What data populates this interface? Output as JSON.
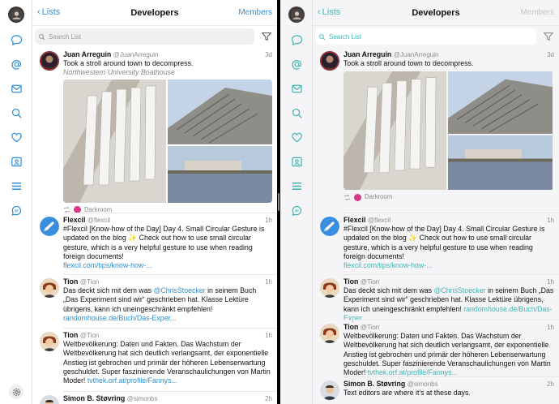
{
  "colors": {
    "accent_left": "#2f8fd8",
    "accent_right": "#3fb6b5",
    "retweet_icon": "#8a8a8e",
    "darkroom": "#d9368b"
  },
  "header": {
    "back_label": "Lists",
    "title": "Developers",
    "members_label": "Members"
  },
  "search": {
    "placeholder": "Search List"
  },
  "nav_icons": [
    "avatar",
    "speech-bubble-icon",
    "at-icon",
    "mail-icon",
    "search-icon",
    "heart-icon",
    "contact-card-icon",
    "list-icon",
    "chat-bubble-icon",
    "gear-icon"
  ],
  "tweets": [
    {
      "name": "Juan Arreguin",
      "handle": "@JuanArreguin",
      "time": "3d",
      "text": "Took a stroll around town to decompress.",
      "location": "Northwestern University Boathouse",
      "app": "Darkroom"
    },
    {
      "name": "Flexcil",
      "handle": "@flexcil",
      "time": "1h",
      "text": "#Flexcil [Know-how of the Day] Day 4. Small Circular Gesture is updated on the blog ✨ Check out how to use small circular gesture, which is a very helpful gesture to use when reading foreign documents!",
      "link": "flexcil.com/tips/know-how-..."
    },
    {
      "name": "Tion",
      "handle": "@Tion",
      "time": "1h",
      "text_pre": "Das deckt sich mit dem was ",
      "mention": "@ChrisStoecker",
      "text_post": " in seinem Buch „Das Experiment sind wir“ geschrieben hat. Klasse Lektüre übrigens, kann ich uneingeschränkt empfehlen! ",
      "link": "randomhouse.de/Buch/Das-Exper..."
    },
    {
      "name": "Tion",
      "handle": "@Tion",
      "time": "1h",
      "text": "Weltbevölkerung: Daten und Fakten. Das Wachstum der Weltbevölkerung hat sich deutlich verlangsamt, der exponentielle Anstieg ist gebrochen und primär der höheren Lebenserwartung geschuldet. Super faszinierende Veranschaulichungen von Martin Moder! ",
      "link": "tvthek.orf.at/profile/Fannys..."
    },
    {
      "name": "Simon B. Støvring",
      "handle": "@simonbs",
      "time": "2h",
      "text": "Text editors are where it’s at these days."
    }
  ]
}
